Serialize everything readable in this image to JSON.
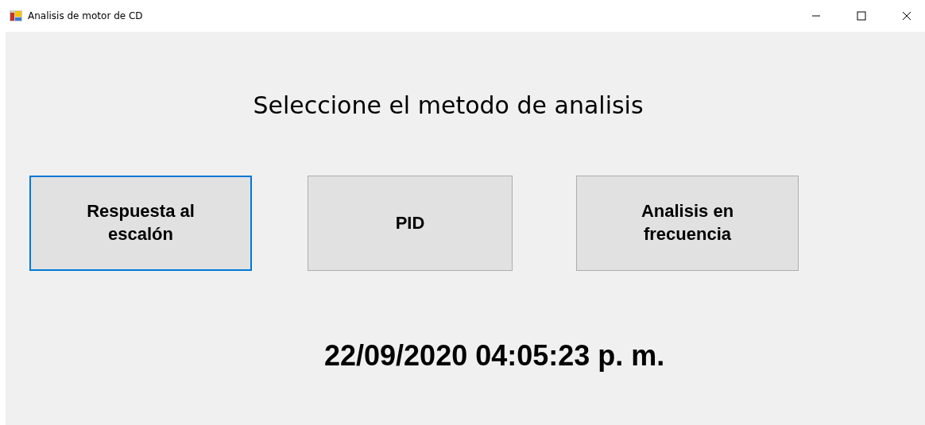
{
  "window": {
    "title": "Analisis de motor de CD"
  },
  "heading": "Seleccione el metodo de analisis",
  "buttons": [
    {
      "label": "Respuesta al escalón",
      "focused": true
    },
    {
      "label": "PID",
      "focused": false
    },
    {
      "label": "Analisis en frecuencia",
      "focused": false
    }
  ],
  "datetime": "22/09/2020 04:05:23 p. m."
}
